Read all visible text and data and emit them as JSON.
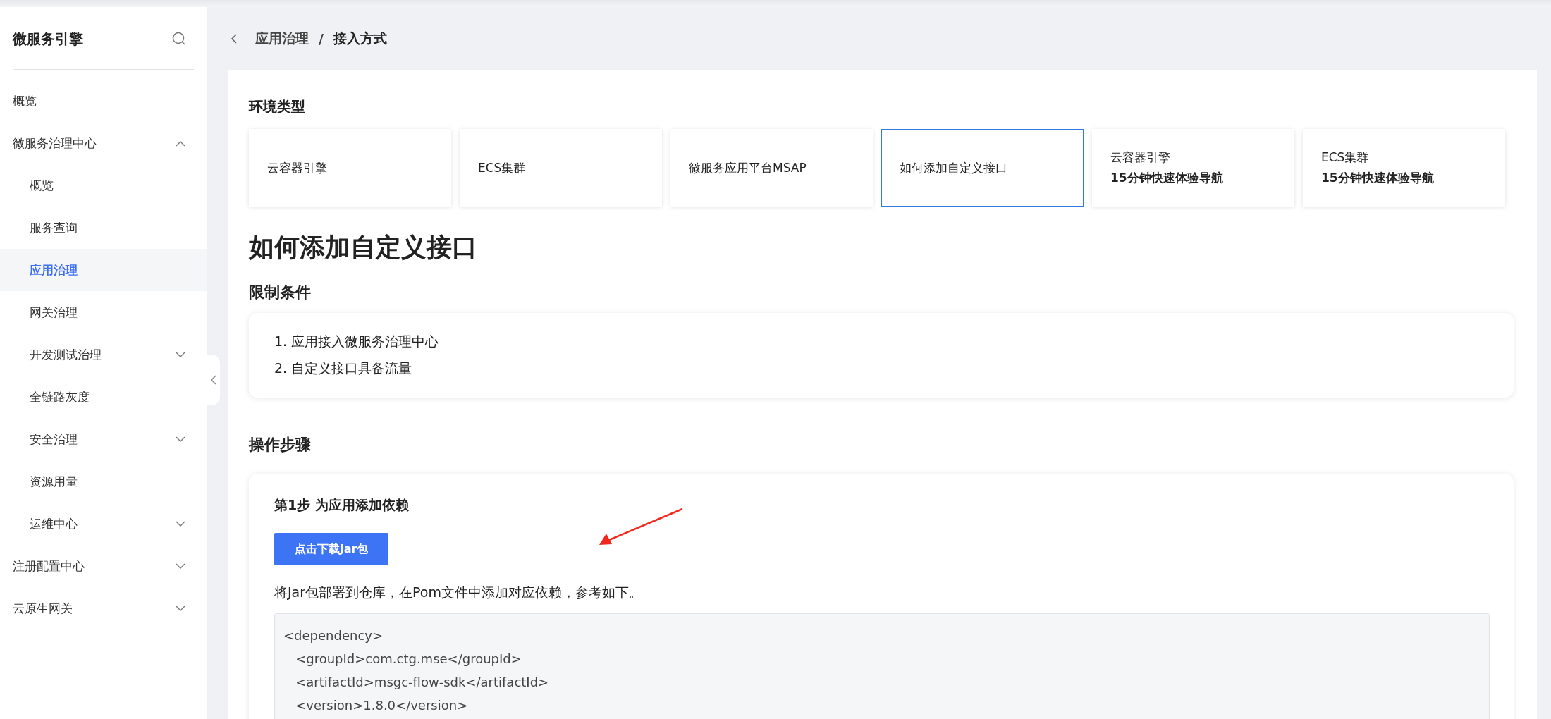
{
  "sidebar": {
    "title": "微服务引擎",
    "items": [
      {
        "label": "概览",
        "selected": false
      },
      {
        "label": "微服务治理中心",
        "expanded": true,
        "children": [
          {
            "label": "概览",
            "selected": false
          },
          {
            "label": "服务查询",
            "selected": false
          },
          {
            "label": "应用治理",
            "selected": true
          },
          {
            "label": "网关治理",
            "selected": false
          },
          {
            "label": "开发测试治理",
            "expanded": false
          },
          {
            "label": "全链路灰度",
            "selected": false
          },
          {
            "label": "安全治理",
            "expanded": false
          },
          {
            "label": "资源用量",
            "selected": false
          },
          {
            "label": "运维中心",
            "expanded": false
          }
        ]
      },
      {
        "label": "注册配置中心",
        "expanded": false
      },
      {
        "label": "云原生网关",
        "expanded": false
      }
    ]
  },
  "breadcrumb": [
    "应用治理",
    "/",
    "接入方式"
  ],
  "env_section": {
    "title": "环境类型",
    "tabs": [
      {
        "label": "云容器引擎",
        "selected": false
      },
      {
        "label": "ECS集群",
        "selected": false
      },
      {
        "label": "微服务应用平台MSAP",
        "selected": false
      },
      {
        "label": "如何添加自定义接口",
        "selected": true
      },
      {
        "label": "云容器引擎",
        "sublabel": "15分钟快速体验导航",
        "selected": false
      },
      {
        "label": "ECS集群",
        "sublabel": "15分钟快速体验导航",
        "selected": false
      }
    ]
  },
  "heading": "如何添加自定义接口",
  "limits": {
    "title": "限制条件",
    "items": [
      "1. 应用接入微服务治理中心",
      "2. 自定义接口具备流量"
    ]
  },
  "steps": {
    "title": "操作步骤",
    "step": {
      "title": "第1步 为应用添加依赖",
      "button": "点击下载Jar包",
      "text": "将Jar包部署到仓库，在Pom文件中添加对应依赖，参考如下。",
      "code": [
        "<dependency>",
        "   <groupId>com.ctg.mse</groupId>",
        "   <artifactId>msgc-flow-sdk</artifactId>",
        "   <version>1.8.0</version>"
      ]
    }
  }
}
